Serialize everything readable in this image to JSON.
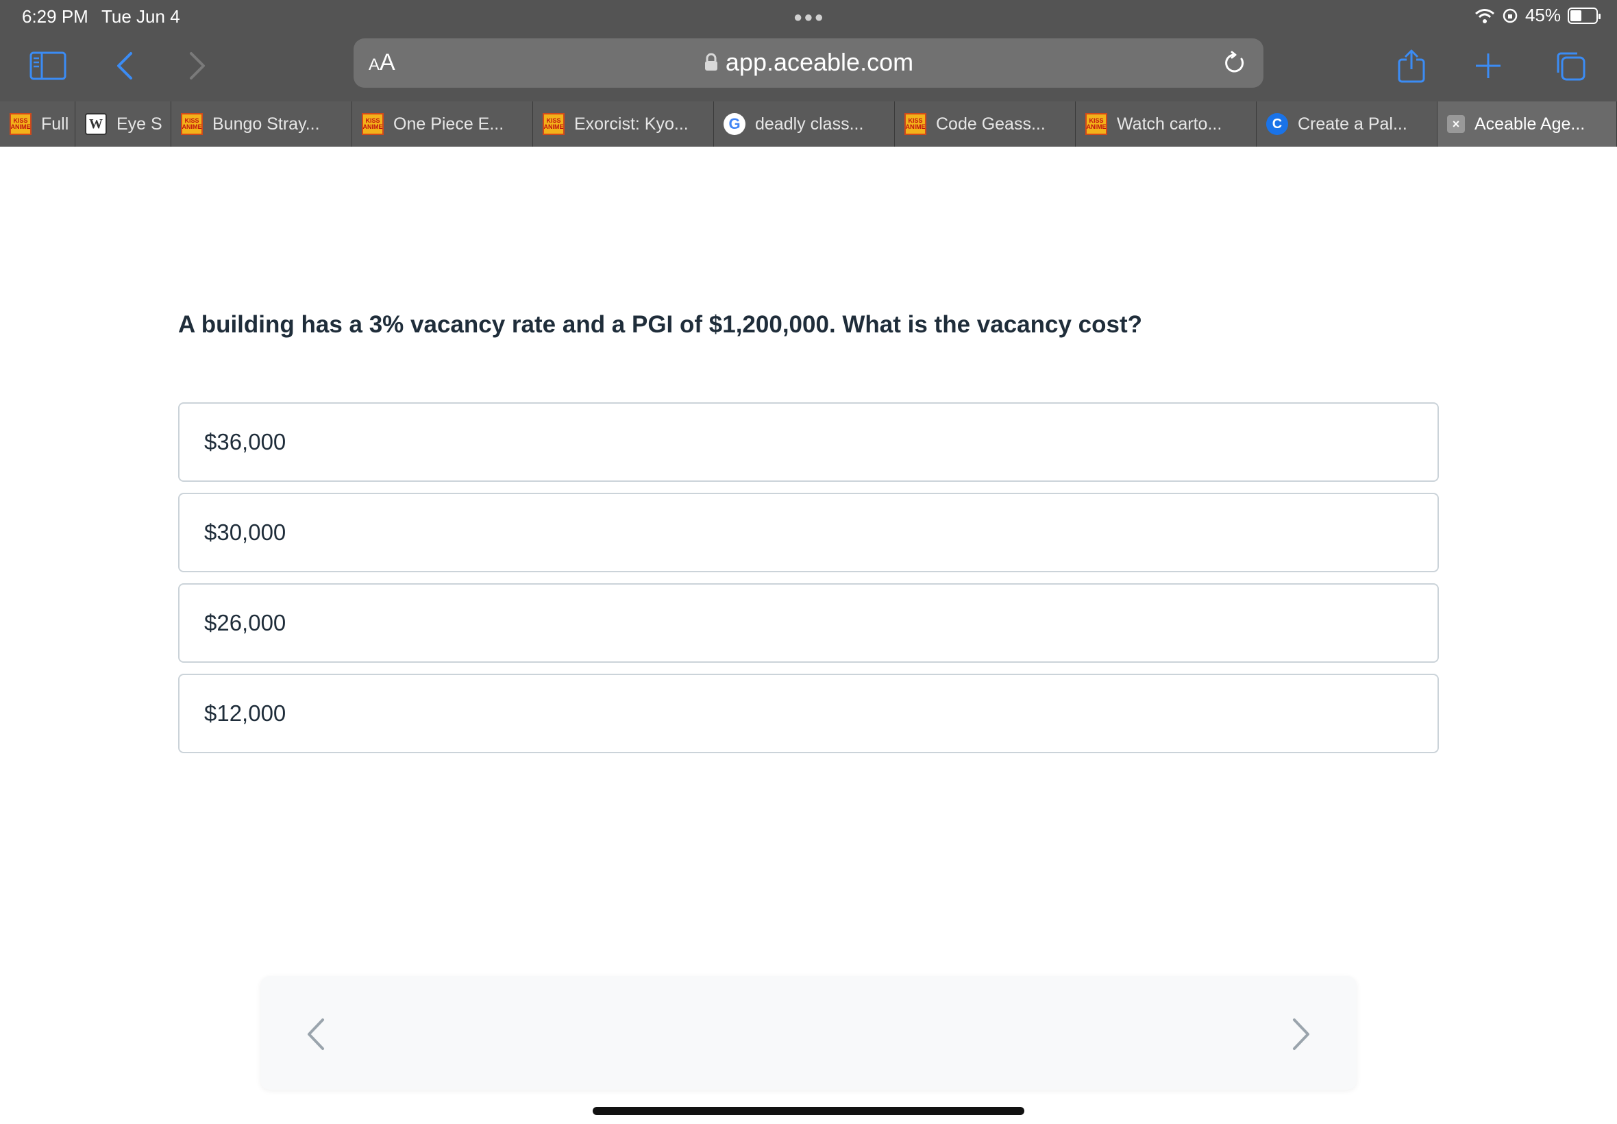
{
  "status": {
    "time": "6:29 PM",
    "date": "Tue Jun 4",
    "battery_text": "45%",
    "battery_level": 0.45
  },
  "toolbar": {
    "aa_label_small": "A",
    "aa_label_large": "A",
    "url": "app.aceable.com",
    "accent_color": "#3b8cf5"
  },
  "tabs": [
    {
      "label": "Full",
      "icon": "kissanime-icon"
    },
    {
      "label": "Eye S",
      "icon": "w-icon"
    },
    {
      "label": "Bungo Stray...",
      "icon": "kissanime-icon"
    },
    {
      "label": "One Piece E...",
      "icon": "kissanime-icon"
    },
    {
      "label": "Exorcist: Kyo...",
      "icon": "kissanime-icon"
    },
    {
      "label": "deadly class...",
      "icon": "google-icon"
    },
    {
      "label": "Code Geass...",
      "icon": "kissanime-icon"
    },
    {
      "label": "Watch carto...",
      "icon": "kissanime-icon"
    },
    {
      "label": "Create a Pal...",
      "icon": "c-icon"
    },
    {
      "label": "Aceable Age...",
      "icon": "close-icon"
    }
  ],
  "quiz": {
    "question": "A building has a 3% vacancy rate and a PGI of $1,200,000. What is the vacancy cost?",
    "answers": [
      "$36,000",
      "$30,000",
      "$26,000",
      "$12,000"
    ]
  }
}
